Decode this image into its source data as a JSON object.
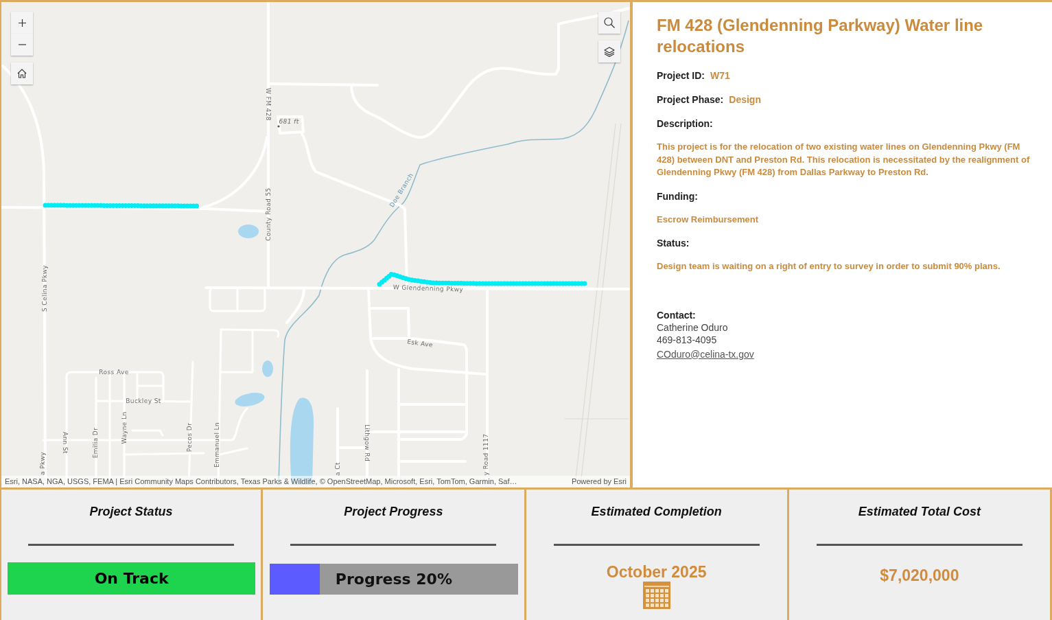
{
  "map": {
    "labels": [
      "W FM 428",
      "681 ft",
      "County Road 55",
      "S Celina Pkwy",
      "Doe Branch",
      "W Glendenning Pkwy",
      "Esk Ave",
      "Ross Ave",
      "Buckley St",
      "Ann St",
      "Emilia Dr",
      "Wayne Ln",
      "Pecos Dr",
      "Emmanuel Ln",
      "Lithgow Rd",
      "a Pkwy",
      "a Ct",
      "y Road 1117"
    ],
    "attribution": "Esri, NASA, NGA, USGS, FEMA | Esri Community Maps Contributors, Texas Parks & Wildlife, © OpenStreetMap, Microsoft, Esri, TomTom, Garmin, Saf…",
    "credit": "Powered by Esri"
  },
  "details": {
    "title": "FM 428 (Glendenning Parkway) Water line relocations",
    "fields": [
      {
        "kind": "inline",
        "label": "Project ID:",
        "value": "W71"
      },
      {
        "kind": "inline",
        "label": "Project Phase:",
        "value": "Design"
      },
      {
        "kind": "block",
        "label": "Description:",
        "value": "This project is for the relocation of two existing water lines on Glendenning Pkwy (FM 428) between DNT and Preston Rd. This relocation is necessitated by the realignment of Glendenning Pkwy (FM 428) from Dallas Parkway to Preston Rd."
      },
      {
        "kind": "block",
        "label": "Funding:",
        "value": "Escrow Reimbursement"
      },
      {
        "kind": "block",
        "label": "Status:",
        "value": "Design team is waiting on a right of entry to survey in order to submit 90% plans."
      }
    ],
    "contact": {
      "label": "Contact:",
      "name": "Catherine Oduro",
      "phone": "469-813-4095",
      "email": "COduro@celina-tx.gov"
    }
  },
  "cards": [
    {
      "kind": "status",
      "title": "Project Status",
      "value": "On Track",
      "color": "#1ed44f"
    },
    {
      "kind": "progress",
      "title": "Project Progress",
      "value": "Progress 20%",
      "level": 0.2
    },
    {
      "kind": "date",
      "title": "Estimated Completion",
      "value": "October 2025"
    },
    {
      "kind": "amount",
      "title": "Estimated Total Cost",
      "value": "$7,020,000"
    }
  ]
}
